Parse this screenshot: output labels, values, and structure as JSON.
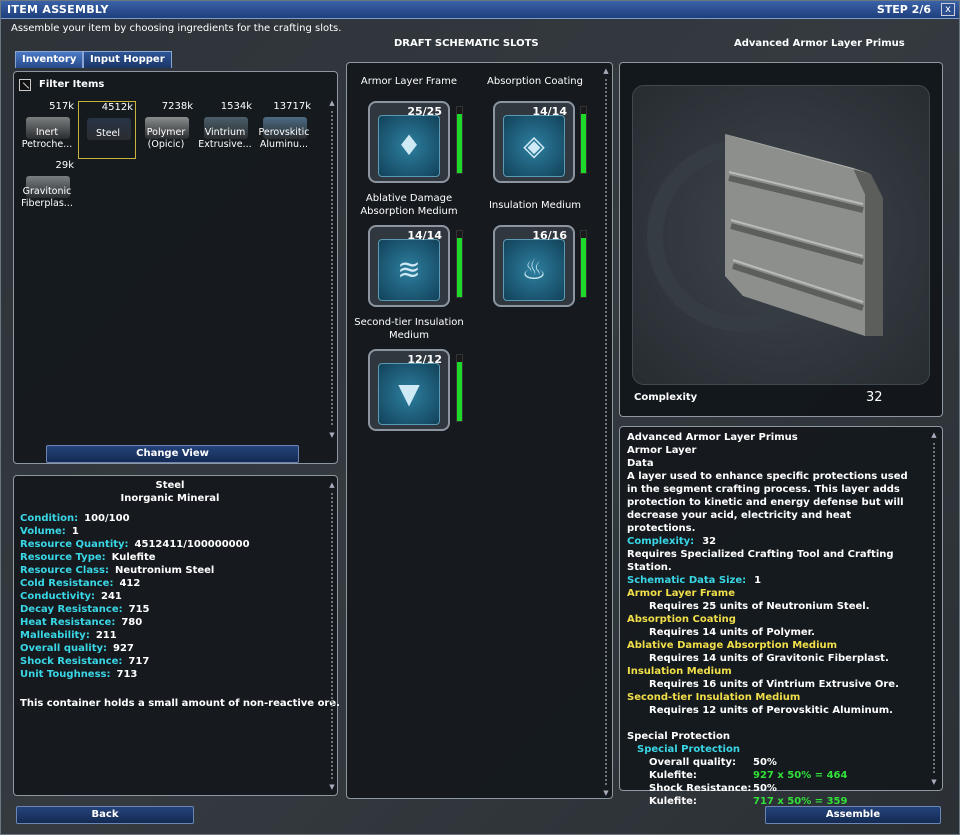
{
  "window": {
    "title": "ITEM ASSEMBLY",
    "step": "STEP 2/6",
    "close": "x",
    "subtitle": "Assemble your item by choosing ingredients for the crafting slots."
  },
  "tabs": [
    "Inventory",
    "Input Hopper"
  ],
  "filter_label": "Filter Items",
  "inventory": [
    {
      "count": "517k",
      "name1": "Inert",
      "name2": "Petroche...",
      "color": "#7c7f80"
    },
    {
      "count": "4512k",
      "name1": "Steel",
      "name2": "",
      "color": "#273445"
    },
    {
      "count": "7238k",
      "name1": "Polymer",
      "name2": "(Opicic)",
      "color": "#8a8d8d"
    },
    {
      "count": "1534k",
      "name1": "Vintrium",
      "name2": "Extrusive...",
      "color": "#4b5e6a"
    },
    {
      "count": "13717k",
      "name1": "Perovskitic",
      "name2": "Aluminu...",
      "color": "#4c6b84"
    },
    {
      "count": "29k",
      "name1": "Gravitonic",
      "name2": "Fiberplas...",
      "color": "#7a8082"
    }
  ],
  "change_view": "Change View",
  "detail": {
    "name": "Steel",
    "category": "Inorganic Mineral",
    "properties": [
      {
        "k": "Condition:",
        "v": "100/100"
      },
      {
        "k": "Volume:",
        "v": "1"
      },
      {
        "k": "Resource Quantity:",
        "v": "4512411/100000000"
      },
      {
        "k": "Resource Type:",
        "v": "Kulefite"
      },
      {
        "k": "Resource Class:",
        "v": "Neutronium Steel"
      },
      {
        "k": "Cold Resistance:",
        "v": "412"
      },
      {
        "k": "Conductivity:",
        "v": "241"
      },
      {
        "k": "Decay Resistance:",
        "v": "715"
      },
      {
        "k": "Heat Resistance:",
        "v": "780"
      },
      {
        "k": "Malleability:",
        "v": "211"
      },
      {
        "k": "Overall quality:",
        "v": "927"
      },
      {
        "k": "Shock Resistance:",
        "v": "717"
      },
      {
        "k": "Unit Toughness:",
        "v": "713"
      }
    ],
    "description": "This container holds a small amount of non-reactive ore."
  },
  "slots_header": "DRAFT SCHEMATIC SLOTS",
  "slots": [
    {
      "label": "Armor Layer Frame",
      "qty": "25/25",
      "fill": 1.0
    },
    {
      "label": "Absorption Coating",
      "qty": "14/14",
      "fill": 1.0
    },
    {
      "label": "Ablative Damage Absorption Medium",
      "qty": "14/14",
      "fill": 1.0
    },
    {
      "label": "Insulation Medium",
      "qty": "16/16",
      "fill": 1.0
    },
    {
      "label": "Second-tier Insulation Medium",
      "qty": "12/12",
      "fill": 1.0
    }
  ],
  "preview": {
    "name": "Advanced Armor Layer Primus",
    "complexity_label": "Complexity",
    "complexity_value": "32"
  },
  "info": {
    "lines": [
      {
        "t": "Advanced Armor Layer Primus",
        "c": ""
      },
      {
        "t": "Armor Layer",
        "c": ""
      },
      {
        "t": "Data",
        "c": ""
      },
      {
        "t": "A layer used to enhance specific protections used in the segment crafting process.  This layer adds protection to kinetic and energy defense but will decrease your acid, electricity and heat protections.",
        "c": ""
      }
    ],
    "complexity_k": "Complexity:",
    "complexity_v": "32",
    "requires": "Requires Specialized Crafting Tool and Crafting Station.",
    "data_size_k": "Schematic Data Size:",
    "data_size_v": "1",
    "reqs": [
      {
        "slot": "Armor Layer Frame",
        "text": "Requires 25 units of Neutronium Steel."
      },
      {
        "slot": "Absorption Coating",
        "text": "Requires 14 units of Polymer."
      },
      {
        "slot": "Ablative Damage Absorption Medium",
        "text": "Requires 14 units of Gravitonic Fiberplast."
      },
      {
        "slot": "Insulation Medium",
        "text": "Requires 16 units of Vintrium Extrusive Ore."
      },
      {
        "slot": "Second-tier Insulation Medium",
        "text": "Requires 12 units of Perovskitic Aluminum."
      }
    ],
    "special_header": "Special Protection",
    "special_sub": "Special Protection",
    "stats": [
      {
        "a": "Overall quality:",
        "b": "50%",
        "green": false
      },
      {
        "a": "Kulefite:",
        "b": "927 x 50% =  464",
        "green": true
      },
      {
        "a": "Shock Resistance:",
        "b": "50%",
        "green": false
      },
      {
        "a": "Kulefite:",
        "b": "717 x 50% =  359",
        "green": true
      }
    ]
  },
  "buttons": {
    "back": "Back",
    "assemble": "Assemble"
  }
}
